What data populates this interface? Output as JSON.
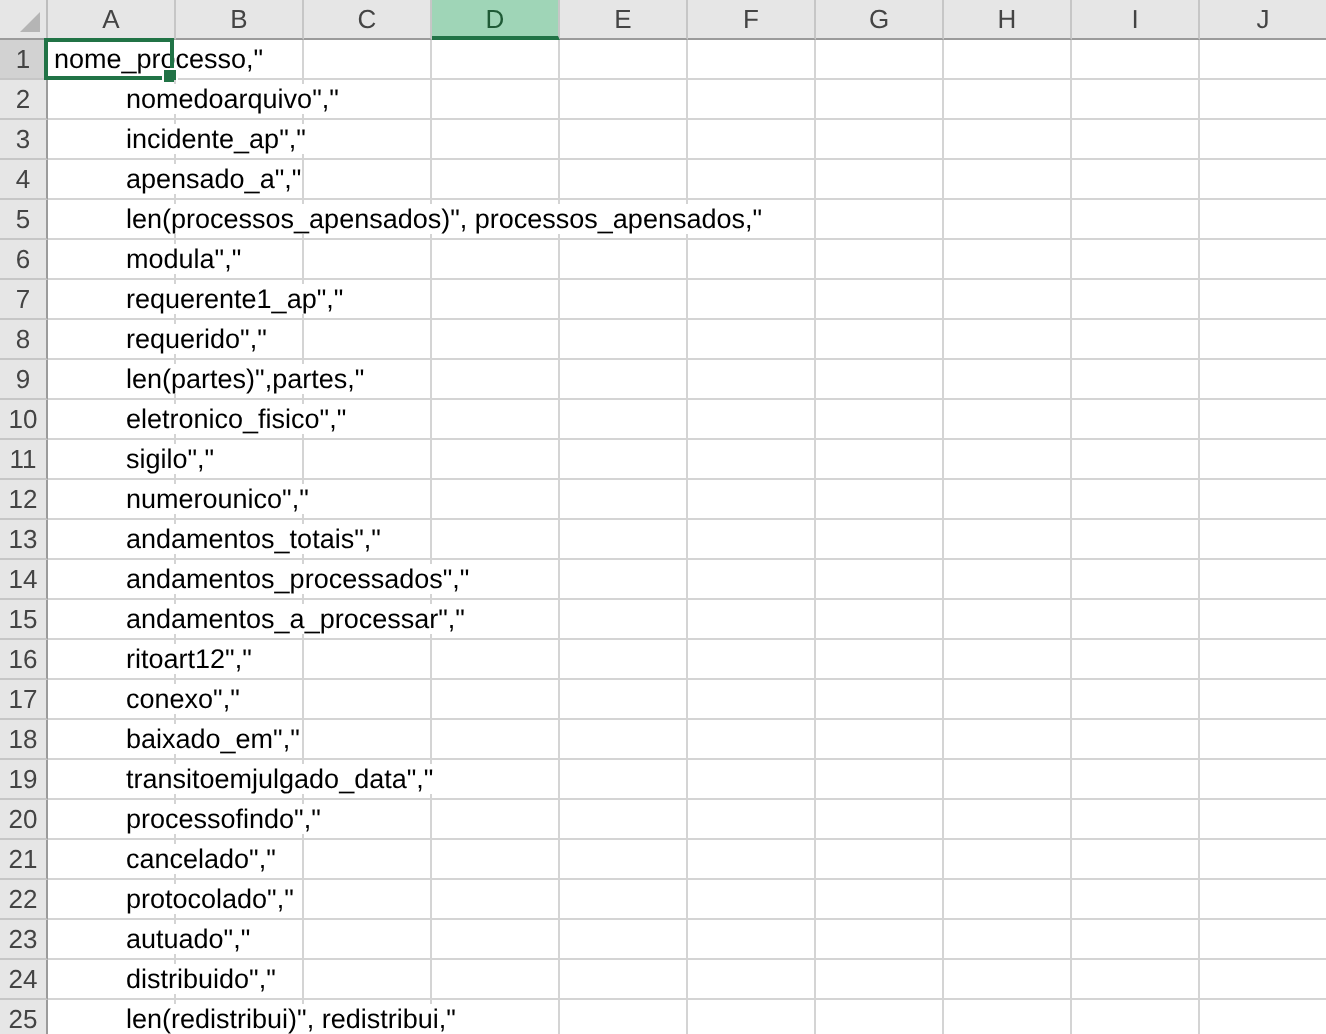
{
  "columns": [
    {
      "label": "A",
      "selected": false
    },
    {
      "label": "B",
      "selected": false
    },
    {
      "label": "C",
      "selected": false
    },
    {
      "label": "D",
      "selected": true
    },
    {
      "label": "E",
      "selected": false
    },
    {
      "label": "F",
      "selected": false
    },
    {
      "label": "G",
      "selected": false
    },
    {
      "label": "H",
      "selected": false
    },
    {
      "label": "I",
      "selected": false
    },
    {
      "label": "J",
      "selected": false
    }
  ],
  "rows": [
    {
      "number": "1",
      "text": "nome_processo,\"",
      "indented": false,
      "active": true
    },
    {
      "number": "2",
      "text": "nomedoarquivo\",\"",
      "indented": true,
      "active": false
    },
    {
      "number": "3",
      "text": "incidente_ap\",\"",
      "indented": true,
      "active": false
    },
    {
      "number": "4",
      "text": "apensado_a\",\"",
      "indented": true,
      "active": false
    },
    {
      "number": "5",
      "text": "len(processos_apensados)\", processos_apensados,\"",
      "indented": true,
      "active": false
    },
    {
      "number": "6",
      "text": "modula\",\"",
      "indented": true,
      "active": false
    },
    {
      "number": "7",
      "text": "requerente1_ap\",\"",
      "indented": true,
      "active": false
    },
    {
      "number": "8",
      "text": "requerido\",\"",
      "indented": true,
      "active": false
    },
    {
      "number": "9",
      "text": "len(partes)\",partes,\"",
      "indented": true,
      "active": false
    },
    {
      "number": "10",
      "text": "eletronico_fisico\",\"",
      "indented": true,
      "active": false
    },
    {
      "number": "11",
      "text": "sigilo\",\"",
      "indented": true,
      "active": false
    },
    {
      "number": "12",
      "text": "numerounico\",\"",
      "indented": true,
      "active": false
    },
    {
      "number": "13",
      "text": "andamentos_totais\",\"",
      "indented": true,
      "active": false
    },
    {
      "number": "14",
      "text": "andamentos_processados\",\"",
      "indented": true,
      "active": false
    },
    {
      "number": "15",
      "text": "andamentos_a_processar\",\"",
      "indented": true,
      "active": false
    },
    {
      "number": "16",
      "text": "ritoart12\",\"",
      "indented": true,
      "active": false
    },
    {
      "number": "17",
      "text": "conexo\",\"",
      "indented": true,
      "active": false
    },
    {
      "number": "18",
      "text": "baixado_em\",\"",
      "indented": true,
      "active": false
    },
    {
      "number": "19",
      "text": "transitoemjulgado_data\",\"",
      "indented": true,
      "active": false
    },
    {
      "number": "20",
      "text": "processofindo\",\"",
      "indented": true,
      "active": false
    },
    {
      "number": "21",
      "text": "cancelado\",\"",
      "indented": true,
      "active": false
    },
    {
      "number": "22",
      "text": "protocolado\",\"",
      "indented": true,
      "active": false
    },
    {
      "number": "23",
      "text": "autuado\",\"",
      "indented": true,
      "active": false
    },
    {
      "number": "24",
      "text": "distribuido\",\"",
      "indented": true,
      "active": false
    },
    {
      "number": "25",
      "text": "len(redistribui)\", redistribui,\"",
      "indented": true,
      "active": false
    }
  ]
}
